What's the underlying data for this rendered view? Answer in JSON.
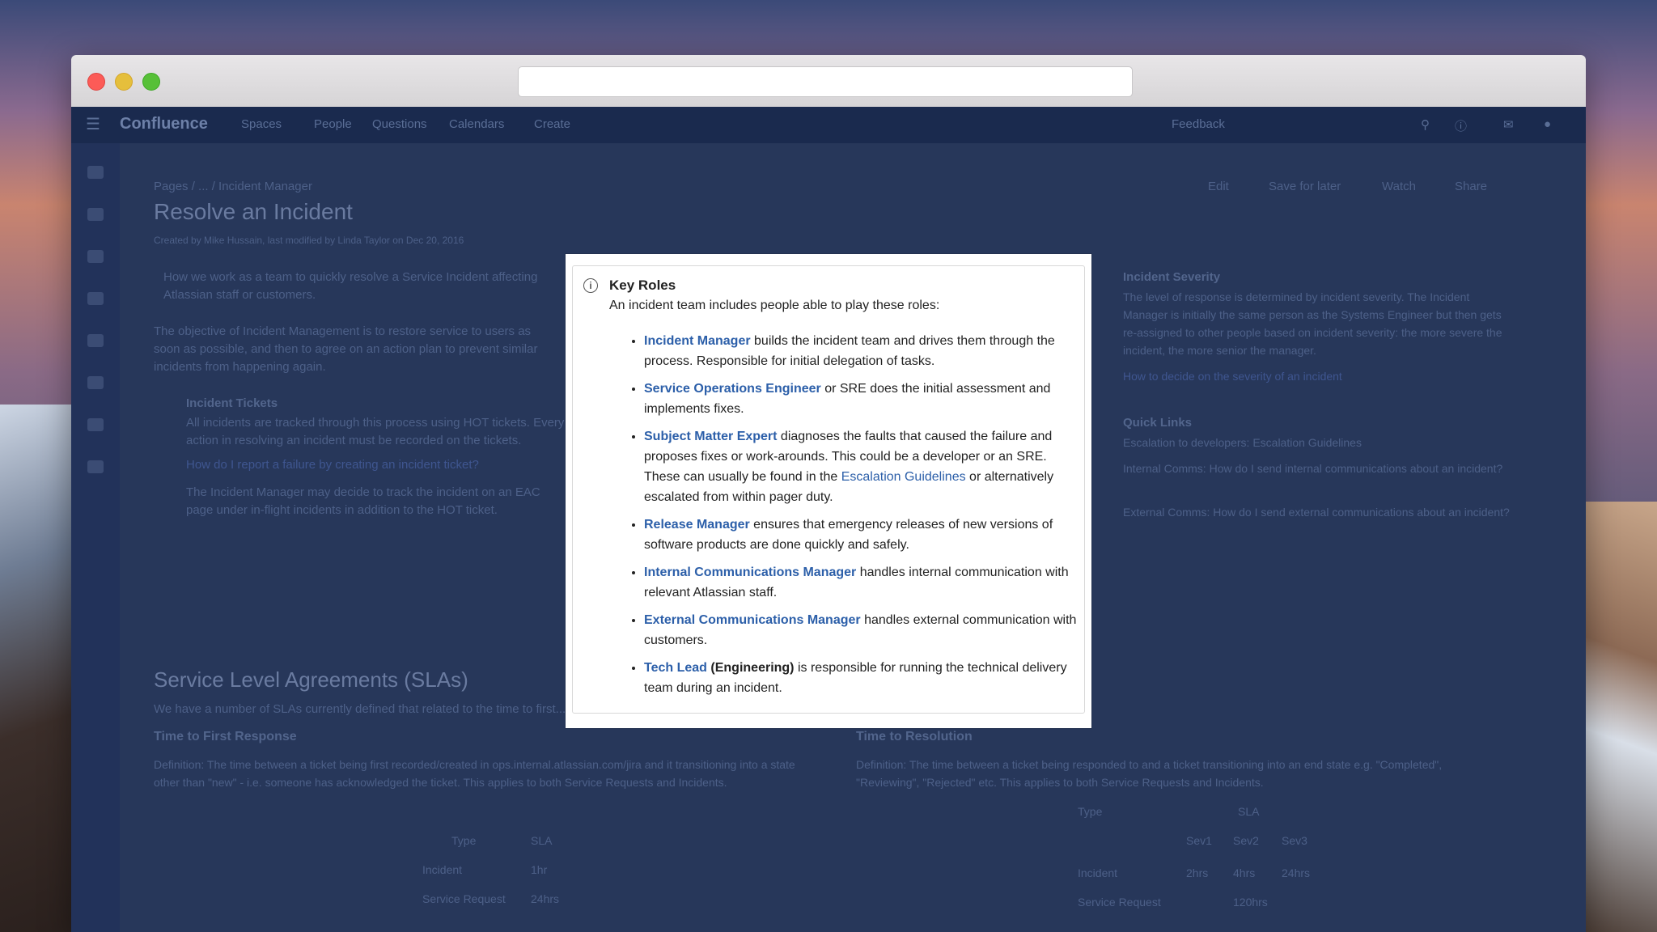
{
  "nav": {
    "logo": "Confluence",
    "spaces": "Spaces",
    "people": "People",
    "questions": "Questions",
    "calendars": "Calendars",
    "create": "Create",
    "feedback": "Feedback"
  },
  "page": {
    "breadcrumb": "Pages / ... / Incident Manager",
    "actions": {
      "edit": "Edit",
      "save_for_later": "Save for later",
      "watch": "Watch",
      "share": "Share"
    },
    "title": "Resolve an Incident",
    "byline": "Created by Mike Hussain, last modified by Linda Taylor on Dec 20, 2016",
    "intro": "How we work as a team to quickly resolve a Service Incident affecting Atlassian staff or customers.",
    "objective": "The objective of Incident Management is to restore service to users as soon as possible, and then to agree on an action plan to prevent similar incidents from happening again.",
    "tickets_heading": "Incident Tickets",
    "tickets_text": "All incidents are tracked through this process using HOT tickets. Every action in resolving an incident must be recorded on the tickets.",
    "tickets_link": "How do I report a failure by creating an incident ticket?",
    "tickets_note": "The Incident Manager may decide to track the incident on an EAC page under in-flight incidents in addition to the HOT ticket.",
    "severity_heading": "Incident Severity",
    "severity_text": "The level of response is determined by incident severity. The Incident Manager is initially the same person as the Systems Engineer but then gets re-assigned to other people based on incident severity: the more severe the incident, the more senior the manager.",
    "severity_link": "How to decide on the severity of an incident",
    "quicklinks_heading": "Quick Links",
    "quicklinks_1": "Escalation to developers: Escalation Guidelines",
    "quicklinks_2": "Internal Comms: How do I send internal communications about an incident?",
    "quicklinks_3": "External Comms: How do I send external communications about an incident?",
    "sla_heading": "Service Level Agreements (SLAs)",
    "sla_intro": "We have a number of SLAs currently defined that related to the time to first...",
    "tfr_heading": "Time to First Response",
    "tfr_text": "Definition: The time between a ticket being first recorded/created in ops.internal.atlassian.com/jira and it transitioning into a state other than \"new\" - i.e. someone has acknowledged the ticket. This applies to both Service Requests and Incidents.",
    "ttr_heading": "Time to Resolution",
    "ttr_text": "Definition: The time between a ticket being responded to and a ticket transitioning into an end state e.g. \"Completed\", \"Reviewing\", \"Rejected\" etc. This applies to both Service Requests and Incidents.",
    "tfr_table": {
      "h_type": "Type",
      "h_sla": "SLA",
      "r1_type": "Incident",
      "r1_sla": "1hr",
      "r2_type": "Service Request",
      "r2_sla": "24hrs"
    },
    "ttr_table": {
      "h_type": "Type",
      "h_sla": "SLA",
      "sev1": "Sev1",
      "sev2": "Sev2",
      "sev3": "Sev3",
      "r1_type": "Incident",
      "r1_s1": "2hrs",
      "r1_s2": "4hrs",
      "r1_s3": "24hrs",
      "r2_type": "Service Request",
      "r2_sla": "120hrs"
    }
  },
  "modal": {
    "title": "Key Roles",
    "intro": "An incident team includes people able to play these roles:",
    "roles": [
      {
        "name": "Incident Manager",
        "text": " builds the incident team and drives them through the process. Responsible for initial delegation of tasks."
      },
      {
        "name": "Service Operations Engineer",
        "text": " or SRE does the initial assessment and implements fixes."
      },
      {
        "name": "Subject Matter Expert",
        "text": " diagnoses the faults that caused the failure and proposes fixes or work-arounds. This could be a developer or an SRE. These can usually be found in the ",
        "link": "Escalation Guidelines",
        "text2": " or alternatively escalated from within pager duty."
      },
      {
        "name": "Release Manager",
        "text": " ensures that emergency releases of new versions of software products are done quickly and safely."
      },
      {
        "name": "Internal Communications Manager",
        "text": " handles internal communication with relevant Atlassian staff."
      },
      {
        "name": "External Communications Manager",
        "text": " handles external communication with customers."
      },
      {
        "name": "Tech Lead",
        "strong": " (Engineering)",
        "text": " is responsible for running the technical delivery team during an incident."
      }
    ]
  }
}
